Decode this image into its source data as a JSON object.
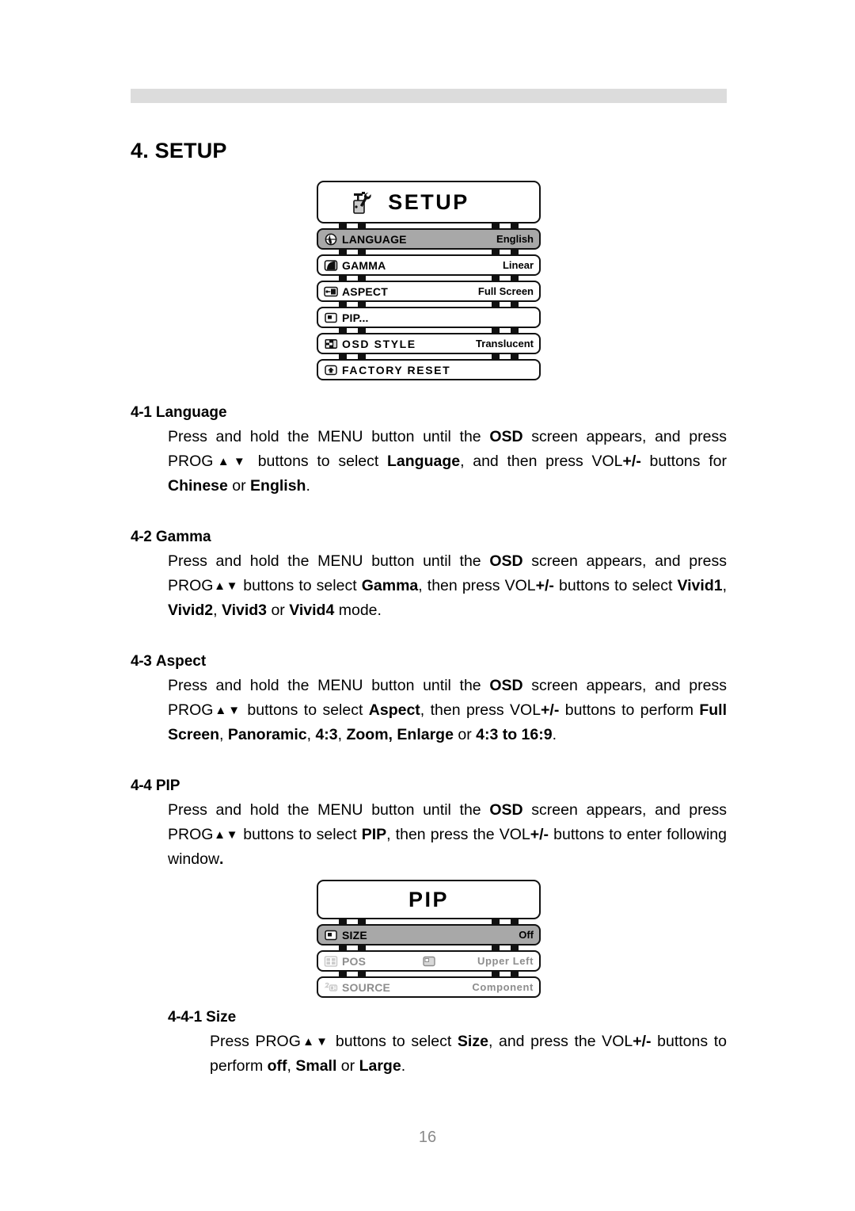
{
  "document": {
    "chapter_title": "4. SETUP",
    "page_number": "16"
  },
  "setup_menu": {
    "title": "SETUP",
    "title_icon": "tools-icon",
    "rows": [
      {
        "icon": "globe-icon",
        "label": "LANGUAGE",
        "value": "English",
        "selected": true,
        "disabled": false
      },
      {
        "icon": "gamma-curve-icon",
        "label": "GAMMA",
        "value": "Linear",
        "selected": false,
        "disabled": false
      },
      {
        "icon": "aspect-ratio-icon",
        "label": "ASPECT",
        "value": "Full Screen",
        "selected": false,
        "disabled": false
      },
      {
        "icon": "pip-window-icon",
        "label": "PIP...",
        "value": "",
        "selected": false,
        "disabled": false
      },
      {
        "icon": "osd-style-icon",
        "label": "OSD  STYLE",
        "value": "Translucent",
        "selected": false,
        "disabled": false
      },
      {
        "icon": "reset-arrow-icon",
        "label": "FACTORY  RESET",
        "value": "",
        "selected": false,
        "disabled": false
      }
    ]
  },
  "pip_menu": {
    "title": "PIP",
    "rows": [
      {
        "icon": "pip-size-icon",
        "label": "SIZE",
        "value": "Off",
        "mid_icon": "",
        "selected": true,
        "disabled": false
      },
      {
        "icon": "pip-pos-icon",
        "label": "POS",
        "value": "Upper  Left",
        "mid_icon": "pip-corner-icon",
        "selected": false,
        "disabled": true
      },
      {
        "icon": "pip-source-icon",
        "label": "SOURCE",
        "value": "Component",
        "mid_icon": "",
        "selected": false,
        "disabled": true
      }
    ]
  },
  "sections": {
    "language": {
      "heading_num": "4-1",
      "heading_text": "Language",
      "p1_a": "Press and hold the MENU button until the ",
      "p1_osd": "OSD",
      "p1_b": " screen appears, and press PROG",
      "p1_arrows": "▲▼",
      "p1_c": " buttons to select  ",
      "p1_language": "Language",
      "p1_d": ", and then press VOL",
      "p1_plusminus": "+/-",
      "p1_e": " buttons for ",
      "p1_chinese": "Chinese",
      "p1_f": " or ",
      "p1_english": "English",
      "p1_g": "."
    },
    "gamma": {
      "heading_num": "4-2",
      "heading_text": "Gamma",
      "p1_a": "Press and hold the MENU button until the ",
      "p1_osd": "OSD",
      "p1_b": " screen appears, and press PROG",
      "p1_arrows": "▲▼",
      "p1_c": " buttons to select ",
      "p1_gamma": "Gamma",
      "p1_d": ", then press VOL",
      "p1_plusminus": "+/-",
      "p1_e": " buttons to select ",
      "p1_v1": "Vivid1",
      "p1_sep1": ", ",
      "p1_v2": "Vivid2",
      "p1_sep2": ", ",
      "p1_v3": "Vivid3",
      "p1_sep3": " or ",
      "p1_v4": "Vivid4",
      "p1_f": " mode."
    },
    "aspect": {
      "heading_num": "4-3",
      "heading_text": "Aspect",
      "p1_a": "Press and hold the MENU button until the ",
      "p1_osd": "OSD",
      "p1_b": " screen appears, and press PROG",
      "p1_arrows": "▲▼",
      "p1_c": " buttons to select ",
      "p1_aspect": "Aspect",
      "p1_d": ", then press VOL",
      "p1_plusminus": "+/-",
      "p1_e": " buttons to perform ",
      "p1_o1": "Full Screen",
      "p1_sep1": ", ",
      "p1_o2": "Panoramic",
      "p1_sep2": ", ",
      "p1_o3": "4:3",
      "p1_sep3": ", ",
      "p1_o4": "Zoom,",
      "p1_sep4": " ",
      "p1_o5": "Enlarge",
      "p1_sep5": " or ",
      "p1_o6": "4:3 to 16:9",
      "p1_f": "."
    },
    "pip": {
      "heading_num": "4-4",
      "heading_text": "PIP",
      "p1_a": "Press and hold the MENU button until the ",
      "p1_osd": "OSD",
      "p1_b": " screen appears, and press PROG",
      "p1_arrows": "▲▼",
      "p1_c": " buttons to select ",
      "p1_pip": "PIP",
      "p1_d": ", then press the VOL",
      "p1_plusminus": "+/-",
      "p1_e": " buttons to enter following window",
      "p1_f": "."
    },
    "size": {
      "heading_num": "4-4-1",
      "heading_text": "Size",
      "p1_a": "Press PROG",
      "p1_arrows": "▲▼",
      "p1_b": " buttons to select ",
      "p1_size": "Size",
      "p1_c": ", and press the VOL",
      "p1_plusminus": "+/-",
      "p1_d": " buttons to perform ",
      "p1_off": "off",
      "p1_sep1": ", ",
      "p1_small": "Small",
      "p1_sep2": " or ",
      "p1_large": "Large",
      "p1_e": "."
    }
  }
}
